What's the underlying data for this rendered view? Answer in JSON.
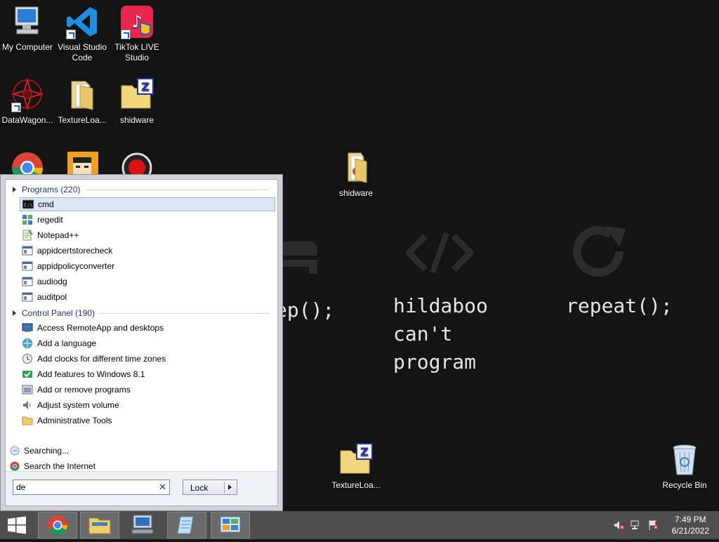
{
  "desktop": {
    "icons": [
      {
        "label": "My Computer",
        "icon": "computer-icon"
      },
      {
        "label": "Visual Studio Code",
        "icon": "vscode-icon"
      },
      {
        "label": "TikTok LIVE Studio",
        "icon": "tiktok-icon"
      },
      {
        "label": "DataWagon...",
        "icon": "datawagon-icon"
      },
      {
        "label": "TextureLoa...",
        "icon": "folder-icon"
      },
      {
        "label": "shidware",
        "icon": "zip-folder-icon"
      },
      {
        "label": "shidware",
        "icon": "folder-icon"
      },
      {
        "label": "TextureLoa...",
        "icon": "zip-folder-icon"
      },
      {
        "label": "Recycle Bin",
        "icon": "recycle-bin-icon"
      }
    ],
    "wallpaper": {
      "left_text": "ep();",
      "center_text": "hildaboo\ncan't\nprogram",
      "right_text": "repeat();"
    }
  },
  "start_menu": {
    "programs_header": "Programs (220)",
    "programs": [
      {
        "label": "cmd",
        "icon": "cmd-icon",
        "selected": true
      },
      {
        "label": "regedit",
        "icon": "regedit-icon"
      },
      {
        "label": "Notepad++",
        "icon": "notepadpp-icon"
      },
      {
        "label": "appidcertstorecheck",
        "icon": "exe-icon"
      },
      {
        "label": "appidpolicyconverter",
        "icon": "exe-icon"
      },
      {
        "label": "audiodg",
        "icon": "exe-icon"
      },
      {
        "label": "auditpol",
        "icon": "exe-icon"
      }
    ],
    "control_panel_header": "Control Panel (190)",
    "control_panel": [
      {
        "label": "Access RemoteApp and desktops",
        "icon": "remoteapp-icon"
      },
      {
        "label": "Add a language",
        "icon": "language-icon"
      },
      {
        "label": "Add clocks for different time zones",
        "icon": "clock-icon"
      },
      {
        "label": "Add features to Windows 8.1",
        "icon": "features-icon"
      },
      {
        "label": "Add or remove programs",
        "icon": "programs-icon"
      },
      {
        "label": "Adjust system volume",
        "icon": "volume-icon"
      },
      {
        "label": "Administrative Tools",
        "icon": "folder-icon"
      }
    ],
    "searching_label": "Searching...",
    "search_internet_label": "Search the Internet",
    "search_value": "de",
    "clear_glyph": "✕",
    "lock_label": "Lock"
  },
  "taskbar": {
    "time": "7:49 PM",
    "date": "6/21/2022",
    "apps": [
      "start-icon",
      "chrome-icon",
      "file-explorer-icon",
      "remote-desktop-icon",
      "notepad-icon",
      "control-panel-icon"
    ],
    "tray": [
      "volume-muted-icon",
      "network-icon",
      "action-center-icon"
    ]
  },
  "colors": {
    "desktop": "#141414",
    "taskbar": "#4e4e4e",
    "group_header": "#1e3287",
    "selection": "#dbe6f4"
  }
}
